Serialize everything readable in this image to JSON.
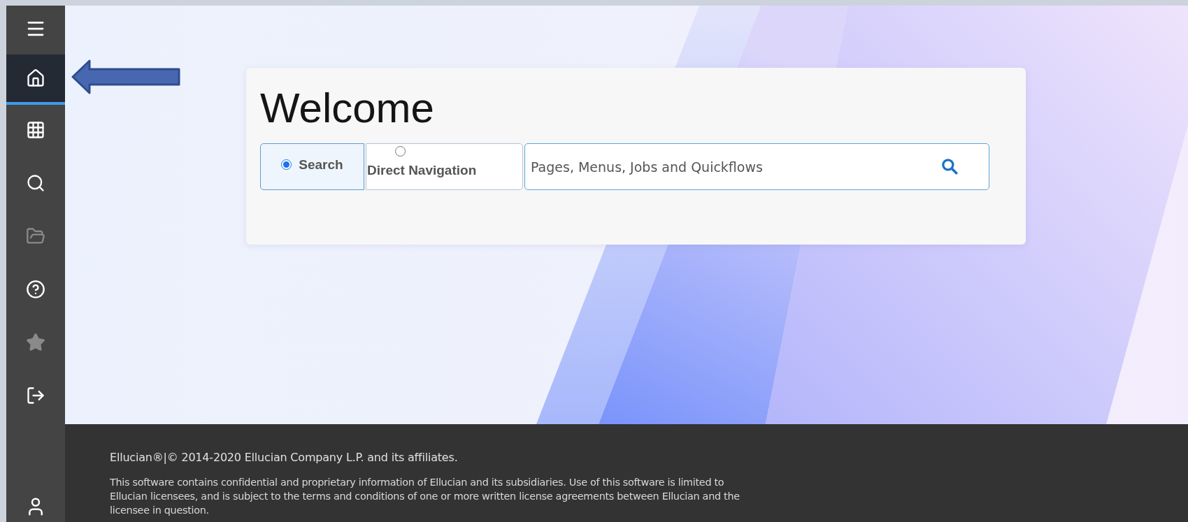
{
  "sidebar": {
    "menu_button": {
      "selected": false
    },
    "items": [
      {
        "selected": true,
        "disabled": false
      },
      {
        "selected": false,
        "disabled": false
      },
      {
        "selected": false,
        "disabled": false
      },
      {
        "selected": false,
        "disabled": true
      },
      {
        "selected": false,
        "disabled": false
      },
      {
        "selected": false,
        "disabled": true
      },
      {
        "selected": false,
        "disabled": false
      }
    ],
    "user_button": {
      "selected": false
    }
  },
  "welcome_card": {
    "title": "Welcome",
    "modes": [
      {
        "label": "Search",
        "selected": true
      },
      {
        "label": "Direct Navigation",
        "selected": false
      }
    ],
    "search": {
      "placeholder": "Pages, Menus, Jobs and Quickflows"
    }
  },
  "footer": {
    "copyright": "Ellucian®|© 2014-2020 Ellucian Company L.P. and its affiliates.",
    "notice": "This software contains confidential and proprietary information of Ellucian and its subsidiaries. Use of this software is limited to Ellucian licensees, and is subject to the terms and conditions of one or more written license agreements between Ellucian and the licensee in question."
  }
}
